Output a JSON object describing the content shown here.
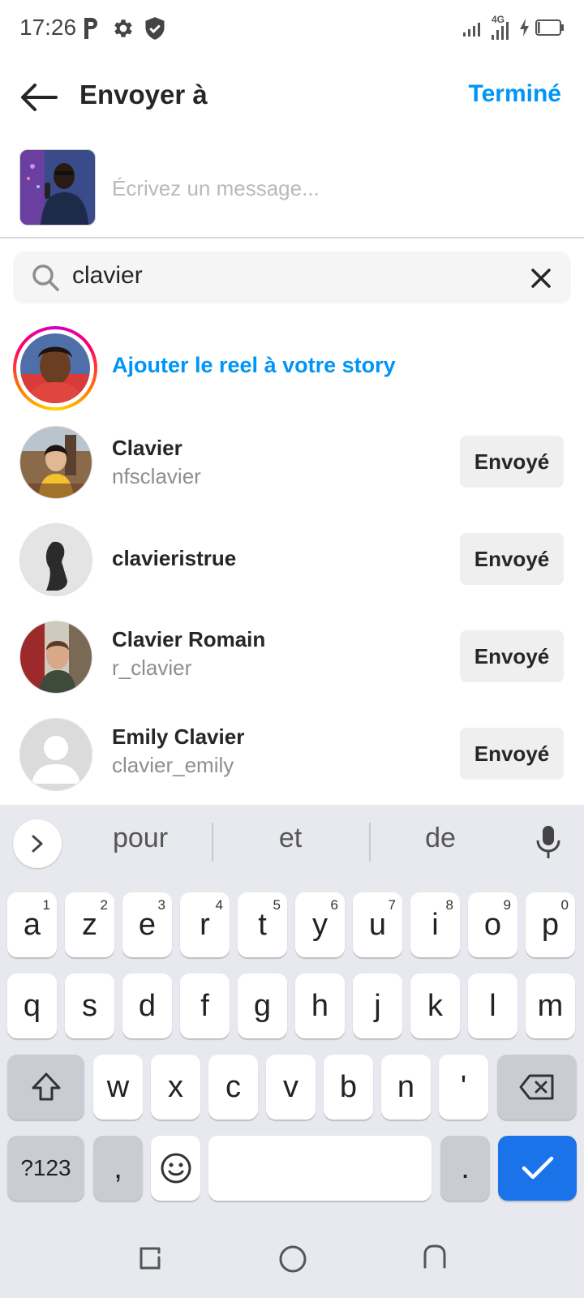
{
  "status_bar": {
    "time": "17:26",
    "network": "4G",
    "battery_level": 0.1
  },
  "header": {
    "title": "Envoyer à",
    "done_label": "Terminé"
  },
  "message": {
    "placeholder": "Écrivez un message..."
  },
  "search": {
    "query": "clavier"
  },
  "story": {
    "label": "Ajouter le reel à votre story"
  },
  "contacts": [
    {
      "name": "Clavier",
      "handle": "nfsclavier",
      "button": "Envoyé"
    },
    {
      "name": "clavieristrue",
      "handle": "",
      "button": "Envoyé"
    },
    {
      "name": "Clavier Romain",
      "handle": "r_clavier",
      "button": "Envoyé"
    },
    {
      "name": "Emily Clavier",
      "handle": "clavier_emily",
      "button": "Envoyé"
    }
  ],
  "keyboard": {
    "suggestions": [
      "pour",
      "et",
      "de"
    ],
    "row1": [
      "a",
      "z",
      "e",
      "r",
      "t",
      "y",
      "u",
      "i",
      "o",
      "p"
    ],
    "row1_hints": [
      "1",
      "2",
      "3",
      "4",
      "5",
      "6",
      "7",
      "8",
      "9",
      "0"
    ],
    "row2": [
      "q",
      "s",
      "d",
      "f",
      "g",
      "h",
      "j",
      "k",
      "l",
      "m"
    ],
    "row3": [
      "w",
      "x",
      "c",
      "v",
      "b",
      "n",
      "'"
    ],
    "symbols_label": "?123",
    "comma": ",",
    "period": "."
  },
  "colors": {
    "accent_blue": "#0095f6",
    "enter_blue": "#1a73e8",
    "keyboard_bg": "#e7e9ee"
  }
}
